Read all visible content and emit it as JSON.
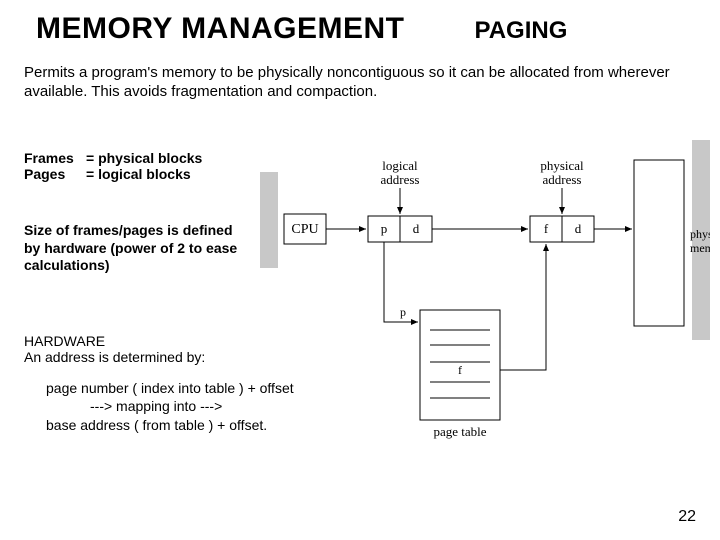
{
  "title": "MEMORY MANAGEMENT",
  "subtitle": "PAGING",
  "description": "Permits a program's memory to be physically noncontiguous so it can be allocated from wherever available. This avoids fragmentation and compaction.",
  "definitions": {
    "frames": {
      "term": "Frames",
      "def": "= physical blocks"
    },
    "pages": {
      "term": "Pages",
      "def": "= logical blocks"
    }
  },
  "size_note": "Size of frames/pages is defined by hardware (power of 2 to ease calculations)",
  "hardware": {
    "heading": "HARDWARE",
    "subheading": "An address is determined by:",
    "line1": "page number ( index into table ) + offset",
    "line2": "---> mapping into --->",
    "line3": "base address ( from table ) + offset."
  },
  "diagram": {
    "cpu": "CPU",
    "p": "p",
    "d": "d",
    "f": "f",
    "logical_address": "logical address",
    "physical_address": "physical address",
    "physical_memory": "physical memory",
    "page_table": "page table"
  },
  "page_number": "22"
}
